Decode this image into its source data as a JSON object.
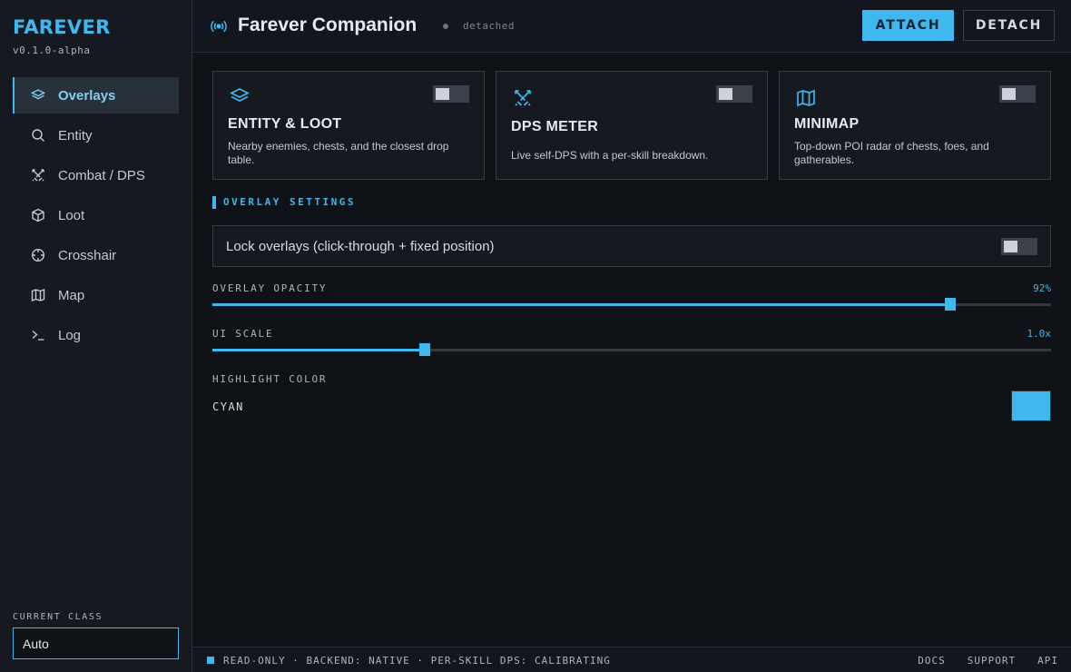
{
  "brand": {
    "name": "FAREVER",
    "version": "v0.1.0-alpha"
  },
  "nav": {
    "items": [
      {
        "label": "Overlays",
        "icon": "layers-icon",
        "active": true
      },
      {
        "label": "Entity",
        "icon": "search-icon"
      },
      {
        "label": "Combat / DPS",
        "icon": "swords-icon"
      },
      {
        "label": "Loot",
        "icon": "box-icon"
      },
      {
        "label": "Crosshair",
        "icon": "crosshair-icon"
      },
      {
        "label": "Map",
        "icon": "map-icon"
      },
      {
        "label": "Log",
        "icon": "terminal-icon"
      }
    ]
  },
  "current_class": {
    "label": "CURRENT CLASS",
    "value": "Auto"
  },
  "header": {
    "title": "Farever Companion",
    "status": "detached",
    "attach_label": "ATTACH",
    "detach_label": "DETACH"
  },
  "cards": [
    {
      "title": "ENTITY & LOOT",
      "desc": "Nearby enemies, chests, and the closest drop table.",
      "icon": "layers-icon",
      "enabled": false
    },
    {
      "title": "DPS METER",
      "desc": "Live self-DPS with a per-skill breakdown.",
      "icon": "swords-icon",
      "enabled": false
    },
    {
      "title": "MINIMAP",
      "desc": "Top-down POI radar of chests, foes, and gatherables.",
      "icon": "map-icon",
      "enabled": false
    }
  ],
  "settings": {
    "title": "OVERLAY SETTINGS",
    "lock_label": "Lock overlays (click-through + fixed position)",
    "lock_enabled": false,
    "opacity": {
      "label": "OVERLAY OPACITY",
      "value": "92%",
      "fraction": 0.88
    },
    "scale": {
      "label": "UI SCALE",
      "value": "1.0x",
      "fraction": 0.253
    },
    "highlight": {
      "label": "HIGHLIGHT COLOR",
      "name": "CYAN",
      "color": "#3fb8ee"
    }
  },
  "footer": {
    "status": "READ-ONLY · BACKEND: NATIVE · PER-SKILL DPS: CALIBRATING",
    "links": [
      "DOCS",
      "SUPPORT",
      "API"
    ]
  },
  "colors": {
    "accent": "#3fb8ee",
    "background": "#0f1217",
    "panel": "#161a20"
  }
}
